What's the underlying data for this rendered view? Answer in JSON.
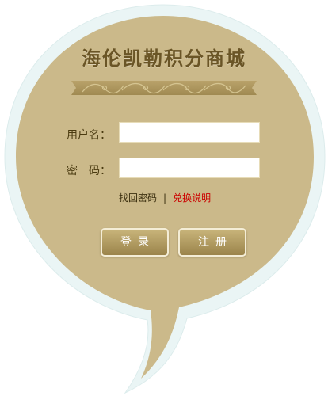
{
  "site": {
    "title": "海伦凯勒积分商城"
  },
  "form": {
    "username_label": "用户名：",
    "password_label": "密　码：",
    "username_value": "",
    "password_value": ""
  },
  "links": {
    "find_password": "找回密码",
    "separator": "|",
    "exchange_rules": "兑换说明"
  },
  "buttons": {
    "login": "登录",
    "register": "注册"
  },
  "colors": {
    "bubble_fill": "#cbb98a",
    "bubble_border": "#eef7f7",
    "title_text": "#6a5526",
    "link_accent": "#cc0000"
  }
}
